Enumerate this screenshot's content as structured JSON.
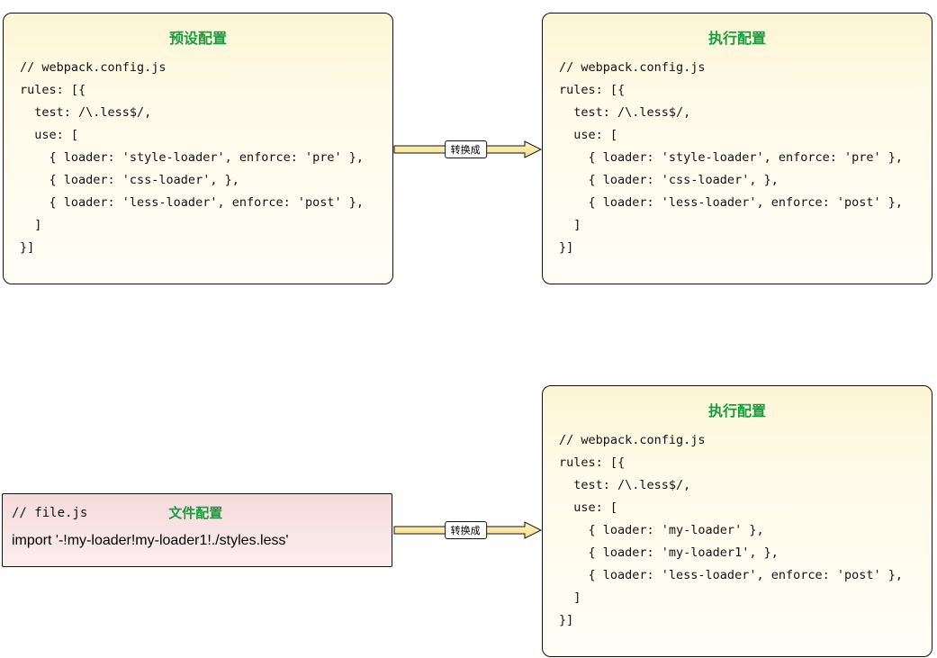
{
  "top": {
    "left": {
      "title": "预设配置",
      "code": "// webpack.config.js\nrules: [{\n  test: /\\.less$/,\n  use: [\n    { loader: 'style-loader', enforce: 'pre' },\n    { loader: 'css-loader', },\n    { loader: 'less-loader', enforce: 'post' },\n  ]\n}]"
    },
    "arrow": "转换成",
    "right": {
      "title": "执行配置",
      "code": "// webpack.config.js\nrules: [{\n  test: /\\.less$/,\n  use: [\n    { loader: 'style-loader', enforce: 'pre' },\n    { loader: 'css-loader', },\n    { loader: 'less-loader', enforce: 'post' },\n  ]\n}]"
    }
  },
  "bottom": {
    "left": {
      "file": "// file.js",
      "label": "文件配置",
      "code": "import '-!my-loader!my-loader1!./styles.less'"
    },
    "arrow": "转换成",
    "right": {
      "title": "执行配置",
      "code": "// webpack.config.js\nrules: [{\n  test: /\\.less$/,\n  use: [\n    { loader: 'my-loader' },\n    { loader: 'my-loader1', },\n    { loader: 'less-loader', enforce: 'post' },\n  ]\n}]"
    }
  }
}
